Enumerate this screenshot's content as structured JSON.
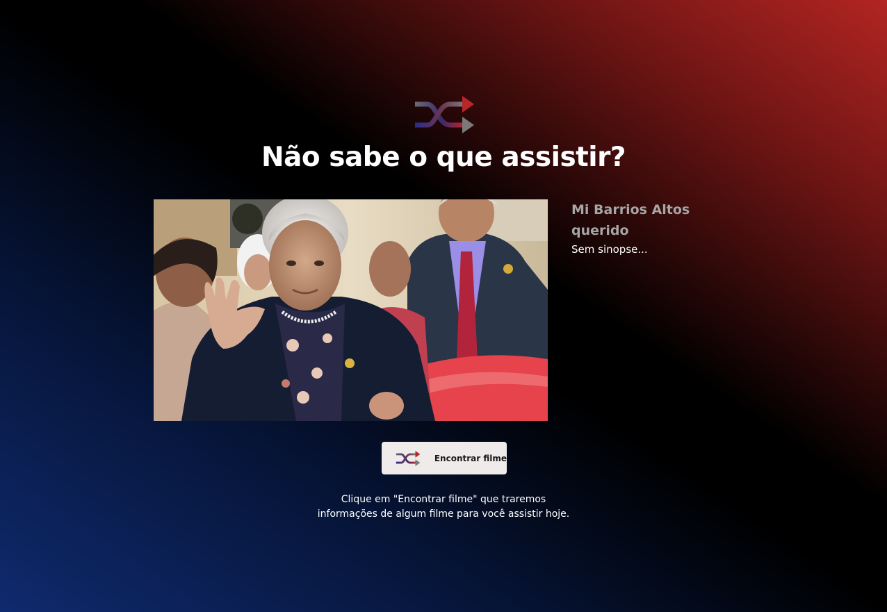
{
  "header": {
    "logo_icon": "shuffle-icon",
    "title": "Não sabe o que assistir?"
  },
  "movie": {
    "title": "Mi Barrios Altos querido",
    "overview": "Sem sinopse...",
    "poster_alt": "Mi Barrios Altos querido"
  },
  "action": {
    "button_icon": "shuffle-icon",
    "button_label": "Encontrar filme"
  },
  "hint": {
    "line1": "Clique em \"Encontrar filme\" que traremos",
    "line2": "informações de algum filme para você assistir hoje."
  },
  "colors": {
    "gradient_red": "#b22522",
    "gradient_black": "#000000",
    "gradient_blue": "#0f2a6e",
    "movie_title": "#a6a6a6",
    "button_bg": "#efebea"
  }
}
